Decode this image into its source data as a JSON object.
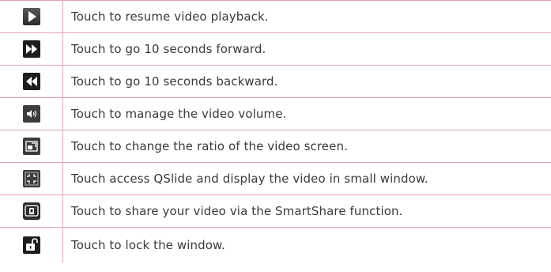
{
  "rows": [
    {
      "icon": "play-icon",
      "text": "Touch to resume video playback."
    },
    {
      "icon": "fast-forward-icon",
      "text": "Touch to go 10 seconds forward."
    },
    {
      "icon": "rewind-icon",
      "text": "Touch to go 10 seconds backward."
    },
    {
      "icon": "volume-icon",
      "text": "Touch to manage the video volume."
    },
    {
      "icon": "screen-ratio-icon",
      "text": "Touch to change the ratio of the video screen."
    },
    {
      "icon": "qslide-icon",
      "text": "Touch access QSlide and display the video in small window."
    },
    {
      "icon": "smartshare-icon",
      "text": "Touch to share your video via the SmartShare function."
    },
    {
      "icon": "lock-icon",
      "text": "Touch to lock the window."
    }
  ],
  "colors": {
    "border": "#e4a3b2",
    "text": "#3a3a3a",
    "icon_dark": "#1e1e1e",
    "icon_gray": "#4a4a4a"
  }
}
